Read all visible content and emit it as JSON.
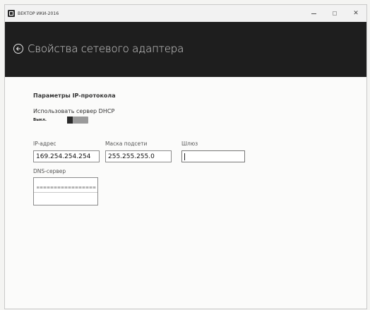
{
  "window": {
    "title": "ВЕКТОР ИКИ-2016",
    "controls": {
      "minimize": "—",
      "maximize": "□",
      "close": "✕"
    }
  },
  "header": {
    "back_icon": "back-arrow-circle-icon",
    "title": "Свойства сетевого адаптера"
  },
  "ip_settings": {
    "section_title": "Параметры IP-протокола",
    "dhcp_label": "Использовать сервер DHCP",
    "dhcp_toggle_state": "Выкл.",
    "dhcp_enabled": false,
    "fields": {
      "ip_address": {
        "label": "IP-адрес",
        "value": "169.254.254.254"
      },
      "subnet_mask": {
        "label": "Маска подсети",
        "value": "255.255.255.0"
      },
      "gateway": {
        "label": "Шлюз",
        "value": ""
      },
      "dns_server": {
        "label": "DNS-сервер",
        "value": ""
      }
    }
  },
  "colors": {
    "header_background": "#1e1e1e",
    "header_text": "#d8d8d8",
    "page_background": "#fbfbfa",
    "toggle_track": "#9a9a9a",
    "toggle_knob": "#2a2a2a"
  }
}
